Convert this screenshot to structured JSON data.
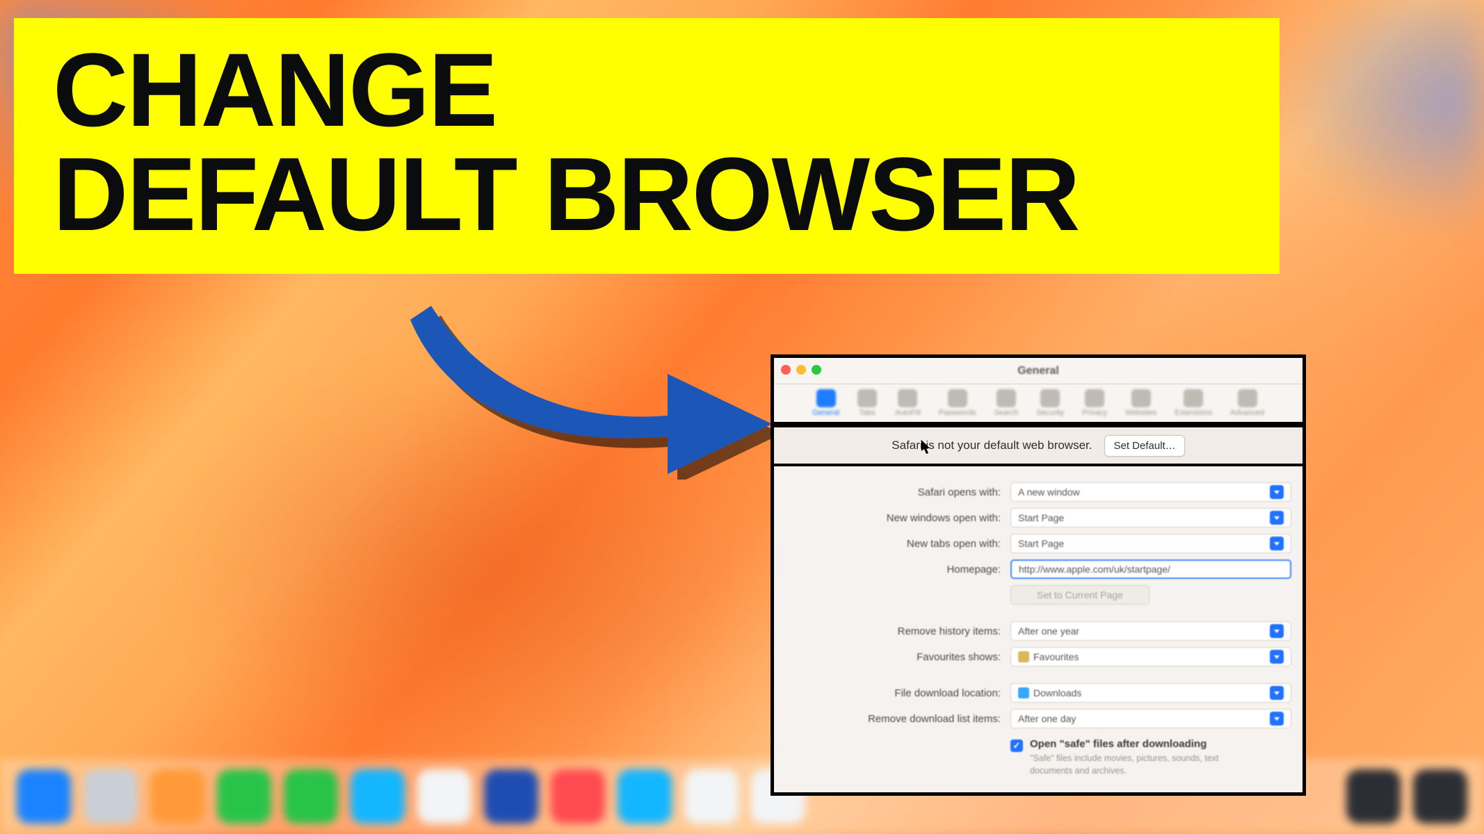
{
  "banner": {
    "line1": "CHANGE",
    "line2": "DEFAULT BROWSER"
  },
  "window": {
    "title": "General",
    "toolbar": {
      "items": [
        {
          "label": "General",
          "active": true
        },
        {
          "label": "Tabs",
          "active": false
        },
        {
          "label": "AutoFill",
          "active": false
        },
        {
          "label": "Passwords",
          "active": false
        },
        {
          "label": "Search",
          "active": false
        },
        {
          "label": "Security",
          "active": false
        },
        {
          "label": "Privacy",
          "active": false
        },
        {
          "label": "Websites",
          "active": false
        },
        {
          "label": "Extensions",
          "active": false
        },
        {
          "label": "Advanced",
          "active": false
        }
      ]
    },
    "notice": {
      "text": "Safari is not your default web browser.",
      "button": "Set Default…"
    },
    "form": {
      "safari_opens_with": {
        "label": "Safari opens with:",
        "value": "A new window"
      },
      "new_windows": {
        "label": "New windows open with:",
        "value": "Start Page"
      },
      "new_tabs": {
        "label": "New tabs open with:",
        "value": "Start Page"
      },
      "homepage": {
        "label": "Homepage:",
        "value": "http://www.apple.com/uk/startpage/"
      },
      "set_current": {
        "label": "",
        "value": "Set to Current Page"
      },
      "remove_history": {
        "label": "Remove history items:",
        "value": "After one year"
      },
      "favourites_shows": {
        "label": "Favourites shows:",
        "value": "Favourites"
      },
      "download_location": {
        "label": "File download location:",
        "value": "Downloads"
      },
      "remove_downloads": {
        "label": "Remove download list items:",
        "value": "After one day"
      },
      "open_safe": {
        "label": "Open \"safe\" files after downloading",
        "hint": "\"Safe\" files include movies, pictures, sounds, text documents and archives.",
        "checked": true
      }
    }
  }
}
